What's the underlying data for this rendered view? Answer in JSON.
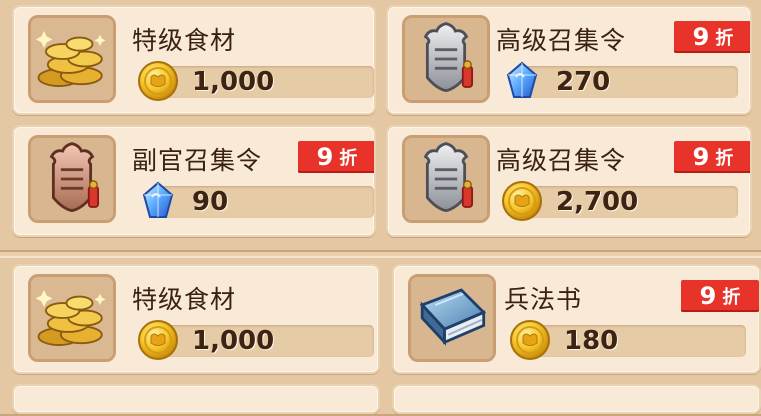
{
  "shop": {
    "top_items": [
      {
        "name": "特级食材",
        "price": "1,000",
        "currency": "coin-icon",
        "discount": null,
        "icon": "food-ingredients-icon"
      },
      {
        "name": "高级召集令",
        "price": "270",
        "currency": "crystal-icon",
        "discount": {
          "num": "9",
          "label": "折"
        },
        "icon": "summon-token-icon"
      },
      {
        "name": "副官召集令",
        "price": "90",
        "currency": "crystal-icon",
        "discount": {
          "num": "9",
          "label": "折"
        },
        "icon": "summon-token-icon"
      },
      {
        "name": "高级召集令",
        "price": "2,700",
        "currency": "coin-icon",
        "discount": {
          "num": "9",
          "label": "折"
        },
        "icon": "summon-token-icon"
      }
    ],
    "bottom_items": [
      {
        "name": "特级食材",
        "price": "1,000",
        "currency": "coin-icon",
        "discount": null,
        "icon": "food-ingredients-icon"
      },
      {
        "name": "兵法书",
        "price": "180",
        "currency": "coin-icon",
        "discount": {
          "num": "9",
          "label": "折"
        },
        "icon": "book-icon"
      }
    ]
  },
  "colors": {
    "coin": "#f2b51b",
    "crystal": "#4a8ff0",
    "discount_bg": "#e7332a",
    "card_bg": "#f8ead6",
    "panel_bg": "#e4c8a4"
  }
}
